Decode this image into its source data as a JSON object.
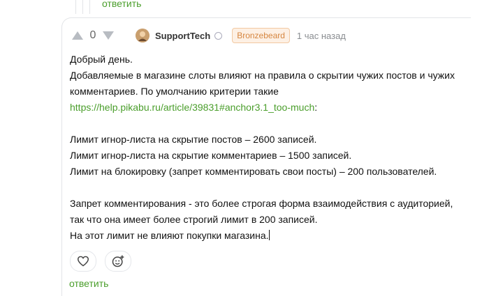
{
  "top_reply": {
    "label": "ответить"
  },
  "comment": {
    "rating": "0",
    "author": "SupportTech",
    "badge": "Bronzebeard",
    "time": "1 час назад",
    "lines": {
      "l1": "Добрый день.",
      "l2": "Добавляемые в магазине слоты влияют на правила о скрытии чужих постов и чужих комментариев. По умолчанию критерии такие",
      "link": "https://help.pikabu.ru/article/39831#anchor3.1_too-much",
      "colon": ":",
      "l4": "Лимит игнор-листа на скрытие постов – 2600 записей.",
      "l5": "Лимит игнор-листа на скрытие комментариев – 1500 записей.",
      "l6": "Лимит на блокировку (запрет комментировать свои посты) – 200 пользователей.",
      "l7": "Запрет комментирования - это более строгая форма взаимодействия с аудиторией, так что она имеет более строгий лимит в 200 записей.",
      "l8": "На этот лимит не влияют покупки магазина."
    },
    "icons": {
      "upvote": "upvote-arrow-icon",
      "downvote": "downvote-arrow-icon",
      "like": "heart-icon",
      "react": "add-emoji-icon",
      "verified": "verified-icon"
    },
    "reply_label": "ответить"
  },
  "colors": {
    "accent_green": "#4a9e2b",
    "badge_orange": "#d68640",
    "muted": "#8a8d91"
  }
}
